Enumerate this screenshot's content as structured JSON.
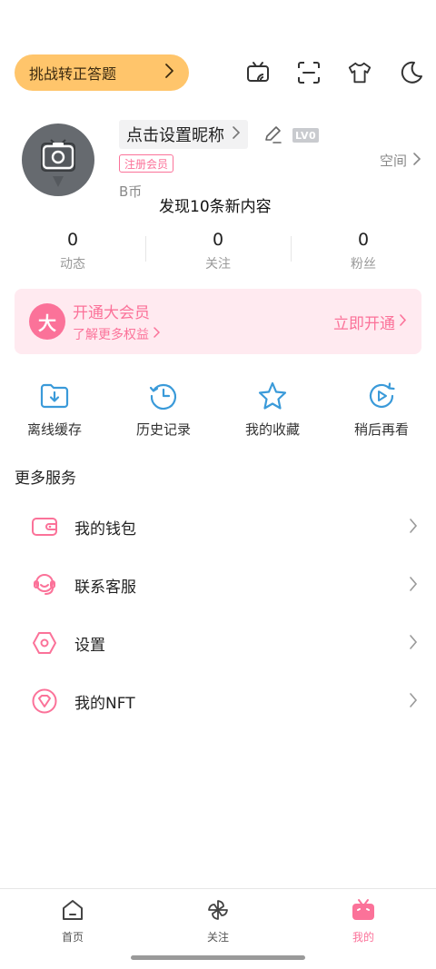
{
  "topbar": {
    "challenge_label": "挑战转正答题",
    "icons": [
      "tv-cast-icon",
      "scan-icon",
      "tshirt-icon",
      "moon-icon"
    ]
  },
  "profile": {
    "nickname": "点击设置昵称",
    "level": "LV0",
    "member_tag": "注册会员",
    "coins": "B币",
    "space_label": "空间"
  },
  "toast": "发现10条新内容",
  "stats": [
    {
      "value": "0",
      "label": "动态"
    },
    {
      "value": "0",
      "label": "关注"
    },
    {
      "value": "0",
      "label": "粉丝"
    }
  ],
  "vip": {
    "badge": "大",
    "title": "开通大会员",
    "subtitle": "了解更多权益",
    "button": "立即开通"
  },
  "quick": [
    {
      "label": "离线缓存",
      "icon": "offline-cache-icon"
    },
    {
      "label": "历史记录",
      "icon": "history-icon"
    },
    {
      "label": "我的收藏",
      "icon": "star-icon"
    },
    {
      "label": "稍后再看",
      "icon": "watch-later-icon"
    }
  ],
  "more_services": {
    "title": "更多服务",
    "items": [
      {
        "label": "我的钱包",
        "icon": "wallet-icon"
      },
      {
        "label": "联系客服",
        "icon": "headset-icon"
      },
      {
        "label": "设置",
        "icon": "settings-icon"
      },
      {
        "label": "我的NFT",
        "icon": "diamond-icon"
      }
    ]
  },
  "bottom_nav": [
    {
      "label": "首页",
      "icon": "home-icon",
      "active": false
    },
    {
      "label": "关注",
      "icon": "pinwheel-icon",
      "active": false
    },
    {
      "label": "我的",
      "icon": "bilibili-tv-icon",
      "active": true
    }
  ],
  "colors": {
    "accent": "#fb7299",
    "challenge_bg": "#ffc56b",
    "vip_bg": "#ffeaf0",
    "icon_blue": "#3a9ad9"
  }
}
